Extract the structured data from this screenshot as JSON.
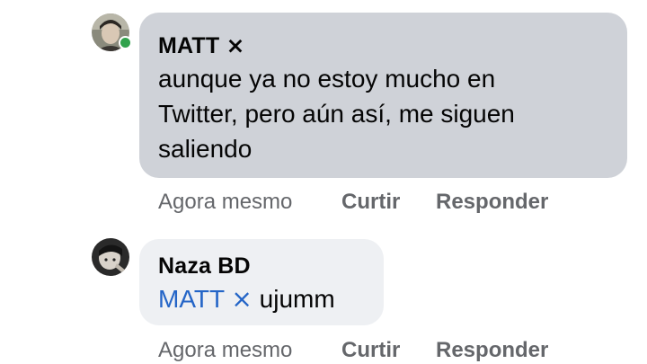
{
  "comments": [
    {
      "author": "MATT ⨯",
      "text": "aunque ya no estoy mucho en\nTwitter, pero aún así, me siguen\nsaliendo",
      "online": true,
      "actions": {
        "time": "Agora mesmo",
        "like": "Curtir",
        "reply": "Responder"
      }
    },
    {
      "author": "Naza BD",
      "mention": "MATT ⨯",
      "text": " ujumm",
      "online": false,
      "actions": {
        "time": "Agora mesmo",
        "like": "Curtir",
        "reply": "Responder"
      }
    }
  ],
  "colors": {
    "bubble_reply": "#cfd2d8",
    "bubble_comment": "#eef0f3",
    "mention": "#2465c7",
    "online": "#31a24c",
    "meta": "#65676b"
  }
}
